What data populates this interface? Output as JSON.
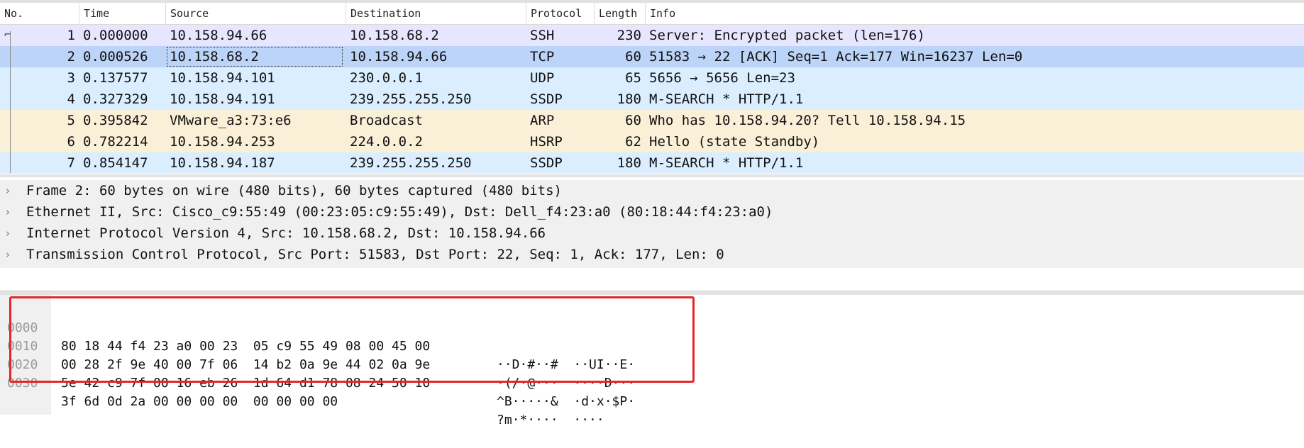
{
  "packet_list": {
    "columns": [
      "No.",
      "Time",
      "Source",
      "Destination",
      "Protocol",
      "Length",
      "Info"
    ],
    "rows": [
      {
        "no": "1",
        "time": "0.000000",
        "source": "10.158.94.66",
        "destination": "10.158.68.2",
        "protocol": "SSH",
        "length": "230",
        "info": "Server: Encrypted packet (len=176)",
        "color": "#e7e6ff"
      },
      {
        "no": "2",
        "time": "0.000526",
        "source": "10.158.68.2",
        "destination": "10.158.94.66",
        "protocol": "TCP",
        "length": "60",
        "info": "51583 → 22 [ACK] Seq=1 Ack=177 Win=16237 Len=0",
        "color": "#bcd4f7",
        "selected": true
      },
      {
        "no": "3",
        "time": "0.137577",
        "source": "10.158.94.101",
        "destination": "230.0.0.1",
        "protocol": "UDP",
        "length": "65",
        "info": "5656 → 5656 Len=23",
        "color": "#daeeff"
      },
      {
        "no": "4",
        "time": "0.327329",
        "source": "10.158.94.191",
        "destination": "239.255.255.250",
        "protocol": "SSDP",
        "length": "180",
        "info": "M-SEARCH * HTTP/1.1",
        "color": "#daeeff"
      },
      {
        "no": "5",
        "time": "0.395842",
        "source": "VMware_a3:73:e6",
        "destination": "Broadcast",
        "protocol": "ARP",
        "length": "60",
        "info": "Who has 10.158.94.20? Tell 10.158.94.15",
        "color": "#faf0d7"
      },
      {
        "no": "6",
        "time": "0.782214",
        "source": "10.158.94.253",
        "destination": "224.0.0.2",
        "protocol": "HSRP",
        "length": "62",
        "info": "Hello (state Standby)",
        "color": "#faf0d7"
      },
      {
        "no": "7",
        "time": "0.854147",
        "source": "10.158.94.187",
        "destination": "239.255.255.250",
        "protocol": "SSDP",
        "length": "180",
        "info": "M-SEARCH * HTTP/1.1",
        "color": "#daeeff"
      }
    ]
  },
  "details": [
    "Frame 2: 60 bytes on wire (480 bits), 60 bytes captured (480 bits)",
    "Ethernet II, Src: Cisco_c9:55:49 (00:23:05:c9:55:49), Dst: Dell_f4:23:a0 (80:18:44:f4:23:a0)",
    "Internet Protocol Version 4, Src: 10.158.68.2, Dst: 10.158.94.66",
    "Transmission Control Protocol, Src Port: 51583, Dst Port: 22, Seq: 1, Ack: 177, Len: 0"
  ],
  "bytes": [
    {
      "offset": "0000",
      "hex": "80 18 44 f4 23 a0 00 23  05 c9 55 49 08 00 45 00",
      "ascii": "··D·#··#  ··UI··E·"
    },
    {
      "offset": "0010",
      "hex": "00 28 2f 9e 40 00 7f 06  14 b2 0a 9e 44 02 0a 9e",
      "ascii": "·(/·@···  ····D···"
    },
    {
      "offset": "0020",
      "hex": "5e 42 c9 7f 00 16 eb 26  1d 64 d1 78 08 24 50 10",
      "ascii": "^B·····&  ·d·x·$P·"
    },
    {
      "offset": "0030",
      "hex": "3f 6d 0d 2a 00 00 00 00  00 00 00 00",
      "ascii": "?m·*····  ····"
    }
  ],
  "colors": {
    "selected_row": "#bcd4f7",
    "highlight_box": "#e3262a"
  }
}
